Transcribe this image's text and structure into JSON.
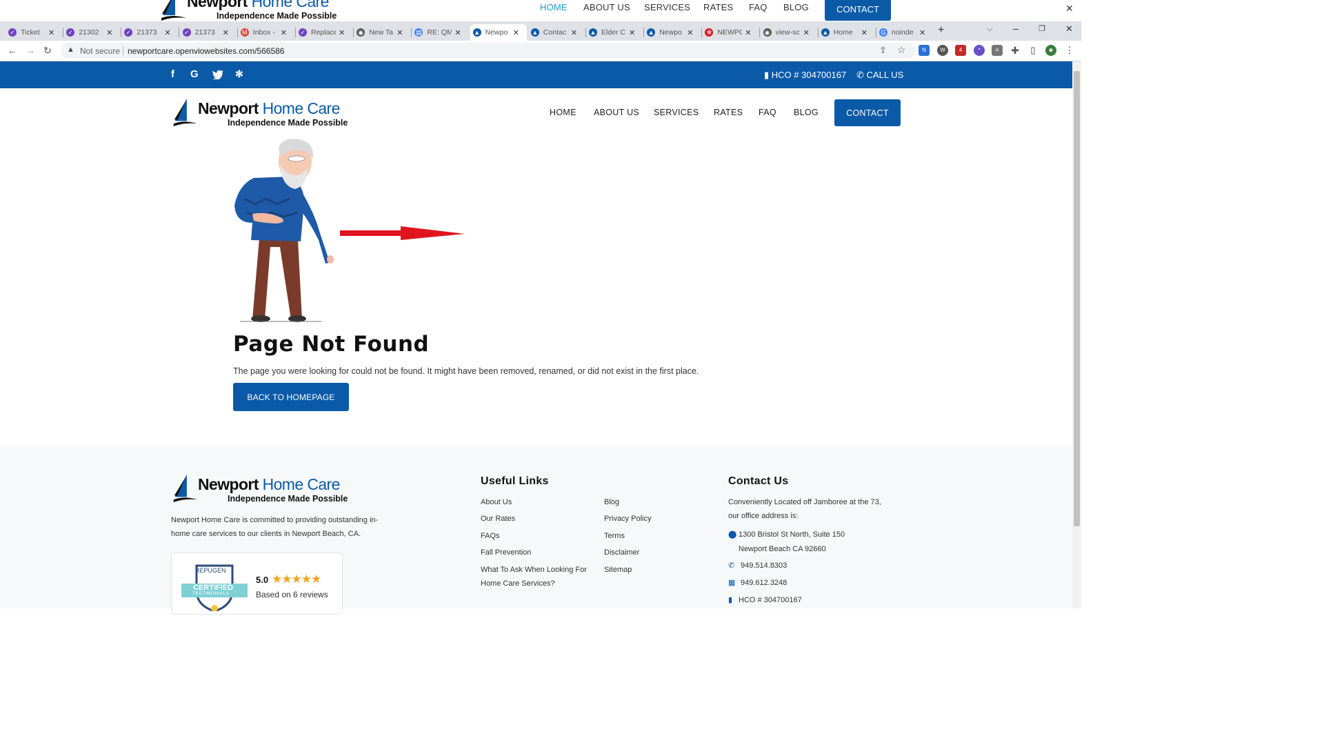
{
  "ghost_header": {
    "logo": {
      "brand_bold": "Newport",
      "brand_light": "Home Care",
      "tagline": "Independence Made Possible"
    },
    "nav": [
      "HOME",
      "ABOUT US",
      "SERVICES",
      "RATES",
      "FAQ",
      "BLOG"
    ],
    "contact": "CONTACT"
  },
  "browser": {
    "tabs": [
      {
        "title": "Ticket",
        "active": false
      },
      {
        "title": "21302",
        "active": false
      },
      {
        "title": "21373",
        "active": false
      },
      {
        "title": "21373",
        "active": false
      },
      {
        "title": "Inbox -",
        "active": false
      },
      {
        "title": "Replace",
        "active": false
      },
      {
        "title": "New Ta",
        "active": false
      },
      {
        "title": "RE: QM",
        "active": false
      },
      {
        "title": "Newpo",
        "active": true
      },
      {
        "title": "Contac",
        "active": false
      },
      {
        "title": "Elder C",
        "active": false
      },
      {
        "title": "Newpo",
        "active": false
      },
      {
        "title": "NEWPO",
        "active": false
      },
      {
        "title": "view-sc",
        "active": false
      },
      {
        "title": "Home",
        "active": false
      },
      {
        "title": "noinde",
        "active": false
      }
    ],
    "security": "Not secure",
    "url": "newportcare.openviowebsites.com/566586"
  },
  "topbar": {
    "hco": "HCO # 304700167",
    "call": "CALL US"
  },
  "header": {
    "logo": {
      "brand_bold": "Newport",
      "brand_light": "Home Care",
      "tagline": "Independence Made Possible"
    },
    "nav": [
      "HOME",
      "ABOUT US",
      "SERVICES",
      "RATES",
      "FAQ",
      "BLOG"
    ],
    "contact": "CONTACT"
  },
  "main": {
    "title": "Page Not Found",
    "description": "The page you were looking for could not be found. It might have been removed, renamed, or did not exist in the first place.",
    "back_button": "BACK TO HOMEPAGE"
  },
  "footer": {
    "logo": {
      "brand_bold": "Newport",
      "brand_light": "Home Care",
      "tagline": "Independence Made Possible"
    },
    "about": "Newport Home Care is committed to providing outstanding in-home care services to our clients in Newport Beach, CA.",
    "about_line1": "Newport Home Care is committed to providing outstanding in-",
    "about_line2": "home care services to our clients in Newport Beach, CA.",
    "badge": {
      "brand": "REPUGEN",
      "certified": "CERTIFIED",
      "testimonials": "TESTIMONIALS",
      "rating": "5.0",
      "reviews": "Based on 6 reviews"
    },
    "useful_links_title": "Useful Links",
    "links_col1": [
      "About Us",
      "Our Rates",
      "FAQs",
      "Fall Prevention",
      "What To Ask When Looking For",
      "Home Care Services?"
    ],
    "links_col2": [
      "Blog",
      "Privacy Policy",
      "Terms",
      "Disclaimer",
      "Sitemap"
    ],
    "contact_title": "Contact Us",
    "contact_intro1": "Conveniently Located off Jamboree at the 73,",
    "contact_intro2": "our office address is:",
    "address1": "1300 Bristol St North, Suite 150",
    "address2": "Newport Beach CA 92660",
    "phone": "949.514.8303",
    "fax": "949.612.3248",
    "hco": "HCO # 304700167"
  },
  "colors": {
    "brand_blue": "#0a5aa8",
    "arrow_red": "#e0141e"
  }
}
